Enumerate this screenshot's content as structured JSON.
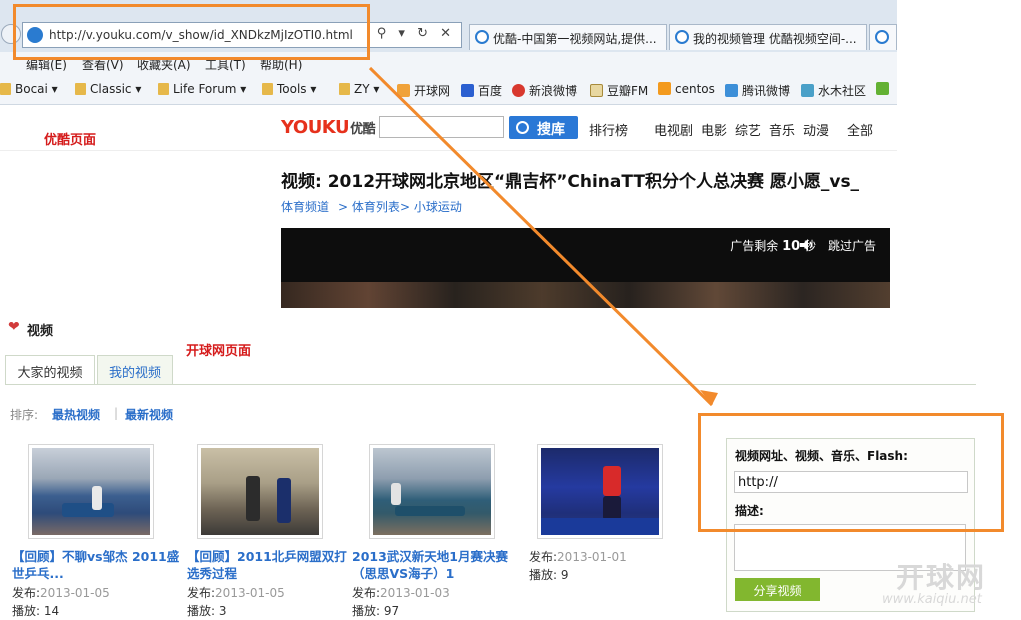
{
  "browser": {
    "url": "http://v.youku.com/v_show/id_XNDkzMjIzOTI0.html",
    "addr_buttons": "⚲ ▾ ↻ ✕",
    "tabs": [
      {
        "label": "优酷-中国第一视频网站,提供..."
      },
      {
        "label": "我的视频管理 优酷视频空间-..."
      },
      {
        "label": "　"
      }
    ],
    "menu": [
      "编辑(E)",
      "查看(V)",
      "收藏夹(A)",
      "工具(T)",
      "帮助(H)"
    ],
    "favorites": [
      "Bocai ▾",
      "Classic ▾",
      "Life Forum ▾",
      "Tools ▾",
      "ZY ▾",
      "开球网",
      "百度",
      "新浪微博",
      "豆瓣FM",
      "centos",
      "腾讯微博",
      "水木社区"
    ]
  },
  "youku": {
    "note": "优酷页面",
    "logo": "YOUKU",
    "logo_cn": "优酷",
    "search_button": "搜库",
    "nav": [
      "排行榜",
      "电视剧",
      "电影",
      "综艺",
      "音乐",
      "动漫",
      "全部"
    ],
    "video_title": "视频: 2012开球网北京地区“鼎吉杯”ChinaTT积分个人总决赛 愿小愿_vs_",
    "breadcrumbs": [
      "体育频道",
      "> 体育列表",
      "> 小球运动"
    ],
    "ad_text_prefix": "广告剩余 ",
    "ad_seconds": "10",
    "ad_text_suffix": " 秒",
    "skip_ad": "跳过广告"
  },
  "kaiqiu": {
    "note": "开球网页面",
    "section_title": "视频",
    "tabs": [
      "大家的视频",
      "我的视频"
    ],
    "sort_label": "排序:",
    "sort_options": [
      "最热视频",
      "最新视频"
    ],
    "videos": [
      {
        "title": "【回顾】不聊vs邹杰  2011盛世乒乓...",
        "published_label": "发布:",
        "date": "2013-01-05",
        "plays_label": "播放:",
        "plays": "14"
      },
      {
        "title": "【回顾】2011北乒网盟双打选秀过程",
        "published_label": "发布:",
        "date": "2013-01-05",
        "plays_label": "播放:",
        "plays": "3"
      },
      {
        "title": "2013武汉新天地1月赛决赛（思思VS海子）1",
        "published_label": "发布:",
        "date": "2013-01-03",
        "plays_label": "播放:",
        "plays": "97"
      },
      {
        "title": "",
        "published_label": "发布:",
        "date": "2013-01-01",
        "plays_label": "播放:",
        "plays": "9"
      }
    ],
    "share": {
      "label": "视频网址、视频、音乐、Flash:",
      "url_value": "http://",
      "desc_label": "描述:",
      "button": "分享视频"
    }
  },
  "watermark": {
    "text": "开球网",
    "sub": "www.kaiqiu.net"
  },
  "colors": {
    "annotation": "#f28a2c",
    "youku_blue": "#2a78d6",
    "link_blue": "#2a6ec9",
    "note_red": "#d51b1b",
    "share_green": "#82b72f"
  }
}
